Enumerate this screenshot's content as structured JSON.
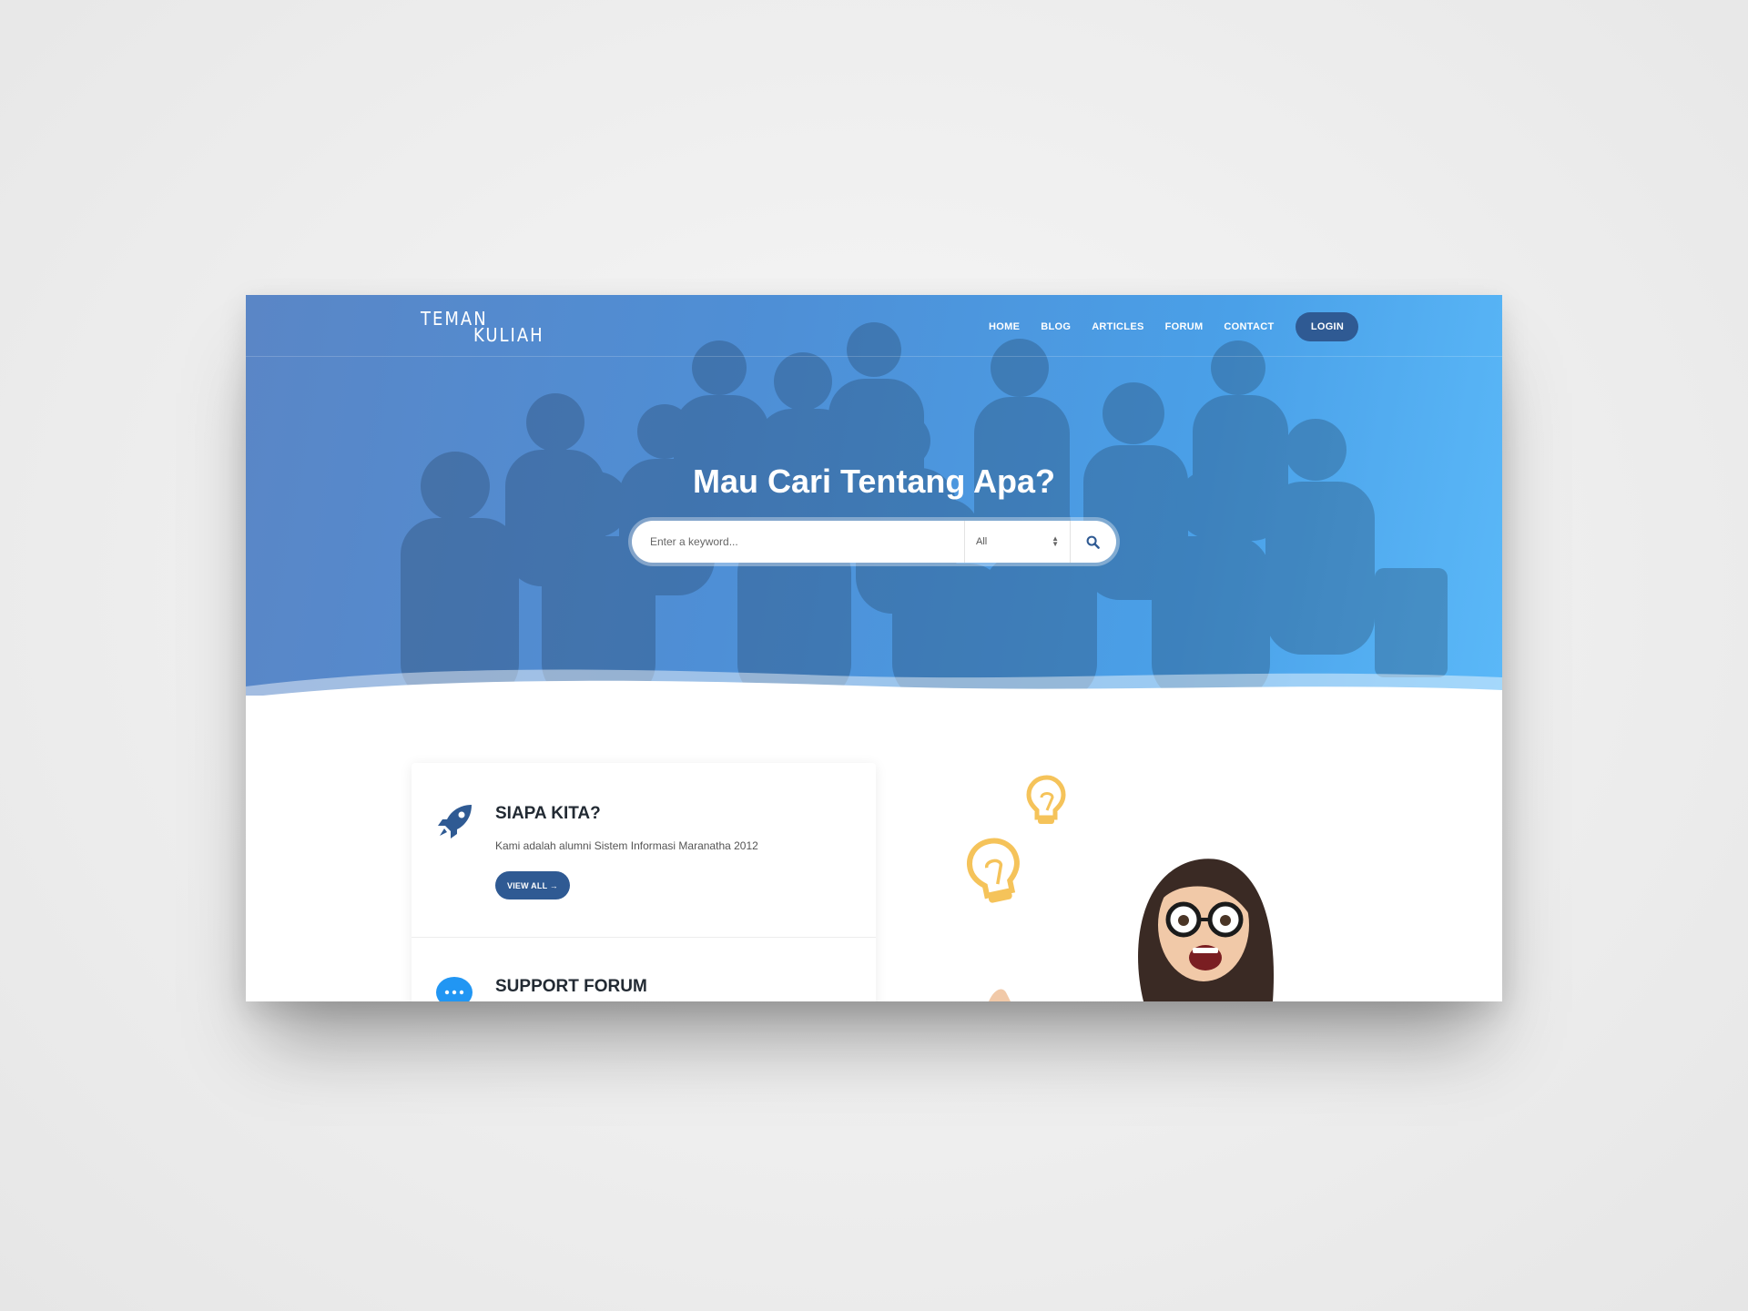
{
  "logo": {
    "line1": "TEMAN",
    "line2": "KULIAH"
  },
  "nav": {
    "items": [
      "HOME",
      "BLOG",
      "ARTICLES",
      "FORUM",
      "CONTACT"
    ],
    "login": "LOGIN"
  },
  "hero": {
    "title": "Mau Cari Tentang Apa?",
    "search_placeholder": "Enter a keyword...",
    "search_category": "All"
  },
  "cards": [
    {
      "title": "SIAPA KITA?",
      "description": "Kami adalah alumni Sistem Informasi Maranatha 2012",
      "button": "VIEW ALL →",
      "icon": "rocket-icon"
    },
    {
      "title": "SUPPORT FORUM",
      "icon": "chat-bubble-icon"
    }
  ],
  "colors": {
    "accent": "#2f5a93",
    "hero_start": "#5a86c6",
    "hero_end": "#5ab8f8",
    "bulb": "#f5c35a",
    "chat_icon": "#2196f3"
  }
}
